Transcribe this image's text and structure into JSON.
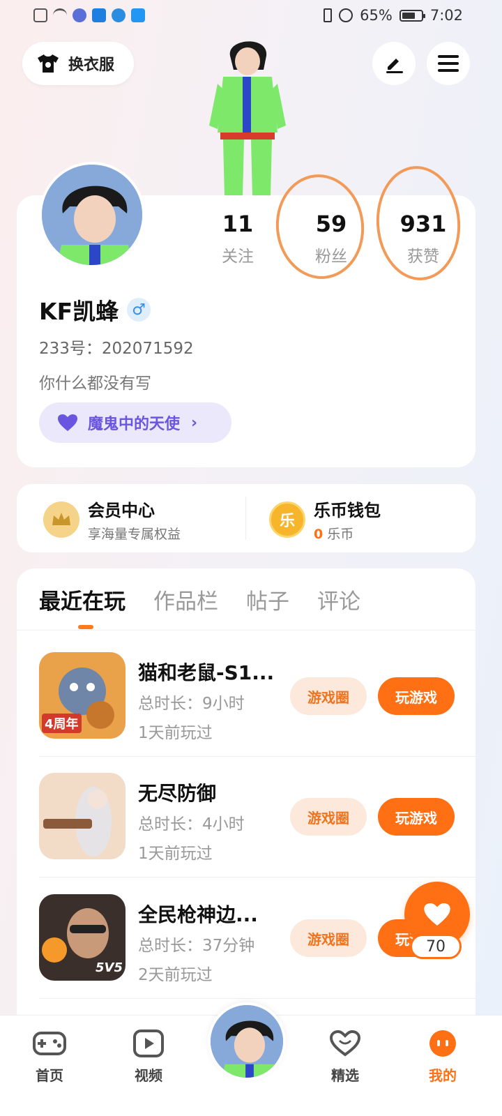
{
  "status_bar": {
    "battery": "65%",
    "time": "7:02"
  },
  "header": {
    "dress_label": "换衣服"
  },
  "profile": {
    "stats": [
      {
        "value": "11",
        "label": "关注"
      },
      {
        "value": "59",
        "label": "粉丝"
      },
      {
        "value": "931",
        "label": "获赞"
      }
    ],
    "username": "KF凯蜂",
    "gender_symbol": "♂",
    "uid": "233号：202071592",
    "bio": "你什么都没有写",
    "tag": "魔鬼中的天使"
  },
  "member": {
    "title": "会员中心",
    "subtitle": "享海量专属权益"
  },
  "wallet": {
    "title": "乐币钱包",
    "amount": "0",
    "unit": "乐币",
    "icon_char": "乐"
  },
  "tabs": [
    "最近在玩",
    "作品栏",
    "帖子",
    "评论"
  ],
  "games": [
    {
      "name": "猫和老鼠-S1...",
      "duration": "总时长：9小时",
      "last_played": "1天前玩过",
      "circle_label": "游戏圈",
      "play_label": "玩游戏",
      "badge": "4周年"
    },
    {
      "name": "无尽防御",
      "duration": "总时长：4小时",
      "last_played": "1天前玩过",
      "circle_label": "游戏圈",
      "play_label": "玩游戏"
    },
    {
      "name": "全民枪神边...",
      "duration": "总时长：37分钟",
      "last_played": "2天前玩过",
      "circle_label": "游戏圈",
      "play_label": "玩游戏",
      "badge": "5V5"
    }
  ],
  "like_count": "70",
  "nav": [
    "首页",
    "视频",
    "精选",
    "我的"
  ],
  "colors": {
    "accent": "#ff6f14",
    "annotation": "#f29a58",
    "tag_purple": "#6a55e0"
  }
}
